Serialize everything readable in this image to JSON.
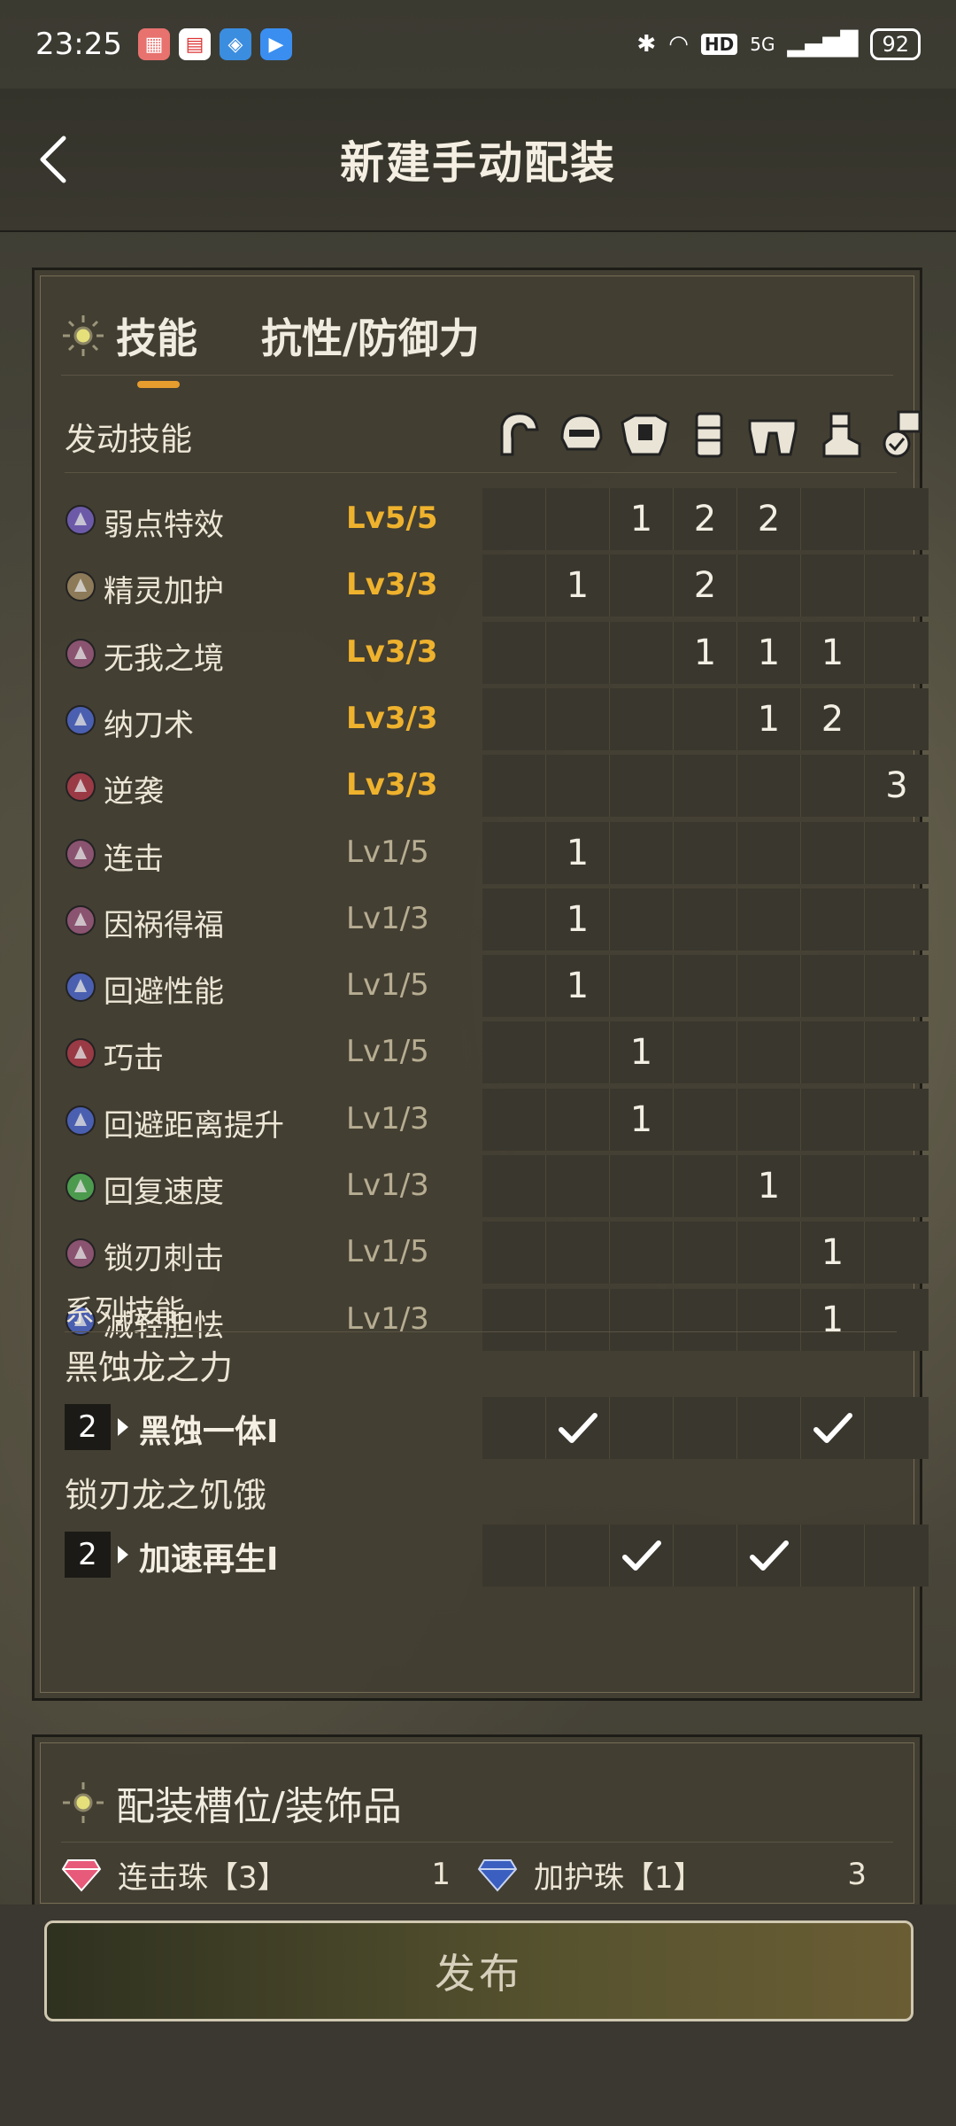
{
  "status_bar": {
    "time": "23:25",
    "network": "5G",
    "hd": "HD",
    "battery": "92"
  },
  "header": {
    "title": "新建手动配装"
  },
  "tabs": [
    {
      "label": "技能",
      "active": true
    },
    {
      "label": "抗性/防御力",
      "active": false
    }
  ],
  "skills_section": {
    "label": "发动技能",
    "armor_icons": [
      "weapon-icon",
      "helmet-icon",
      "chest-icon",
      "arm-icon",
      "waist-icon",
      "leg-icon",
      "talisman-icon"
    ],
    "skills": [
      {
        "name": "弱点特效",
        "level": "Lv5/5",
        "maxed": true,
        "icon": "purple",
        "cells": [
          "",
          "",
          "1",
          "2",
          "2",
          "",
          ""
        ]
      },
      {
        "name": "精灵加护",
        "level": "Lv3/3",
        "maxed": true,
        "icon": "tan",
        "cells": [
          "",
          "1",
          "",
          "2",
          "",
          "",
          ""
        ]
      },
      {
        "name": "无我之境",
        "level": "Lv3/3",
        "maxed": true,
        "icon": "pink",
        "cells": [
          "",
          "",
          "",
          "1",
          "1",
          "1",
          ""
        ]
      },
      {
        "name": "纳刀术",
        "level": "Lv3/3",
        "maxed": true,
        "icon": "blue",
        "cells": [
          "",
          "",
          "",
          "",
          "1",
          "2",
          ""
        ]
      },
      {
        "name": "逆袭",
        "level": "Lv3/3",
        "maxed": true,
        "icon": "red",
        "cells": [
          "",
          "",
          "",
          "",
          "",
          "",
          "3"
        ]
      },
      {
        "name": "连击",
        "level": "Lv1/5",
        "maxed": false,
        "icon": "pink",
        "cells": [
          "",
          "1",
          "",
          "",
          "",
          "",
          ""
        ]
      },
      {
        "name": "因祸得福",
        "level": "Lv1/3",
        "maxed": false,
        "icon": "pink",
        "cells": [
          "",
          "1",
          "",
          "",
          "",
          "",
          ""
        ]
      },
      {
        "name": "回避性能",
        "level": "Lv1/5",
        "maxed": false,
        "icon": "blue",
        "cells": [
          "",
          "1",
          "",
          "",
          "",
          "",
          ""
        ]
      },
      {
        "name": "巧击",
        "level": "Lv1/5",
        "maxed": false,
        "icon": "red",
        "cells": [
          "",
          "",
          "1",
          "",
          "",
          "",
          ""
        ]
      },
      {
        "name": "回避距离提升",
        "level": "Lv1/3",
        "maxed": false,
        "icon": "blue",
        "cells": [
          "",
          "",
          "1",
          "",
          "",
          "",
          ""
        ]
      },
      {
        "name": "回复速度",
        "level": "Lv1/3",
        "maxed": false,
        "icon": "green",
        "cells": [
          "",
          "",
          "",
          "",
          "1",
          "",
          ""
        ]
      },
      {
        "name": "锁刃刺击",
        "level": "Lv1/5",
        "maxed": false,
        "icon": "pink",
        "cells": [
          "",
          "",
          "",
          "",
          "",
          "1",
          ""
        ]
      },
      {
        "name": "减轻胆怯",
        "level": "Lv1/3",
        "maxed": false,
        "icon": "blue",
        "cells": [
          "",
          "",
          "",
          "",
          "",
          "1",
          ""
        ]
      }
    ]
  },
  "set_skills": {
    "label": "系列技能",
    "groups": [
      {
        "name": "黑蚀龙之力",
        "count": "2",
        "bonus": "黑蚀一体I",
        "checks": [
          false,
          true,
          false,
          false,
          false,
          true,
          false
        ]
      },
      {
        "name": "锁刃龙之饥饿",
        "count": "2",
        "bonus": "加速再生I",
        "checks": [
          false,
          false,
          true,
          false,
          true,
          false,
          false
        ]
      }
    ]
  },
  "decorations": {
    "title": "配装槽位/装饰品",
    "items": [
      {
        "name": "连击珠【3】",
        "qty": "1",
        "color": "#e85a7a"
      },
      {
        "name": "加护珠【1】",
        "qty": "3",
        "color": "#5a7fe0"
      }
    ]
  },
  "publish_button": {
    "label": "发布"
  },
  "colors": {
    "accent": "#e79c2e",
    "level_max": "#efb22d",
    "level_normal": "#b7ad92"
  }
}
